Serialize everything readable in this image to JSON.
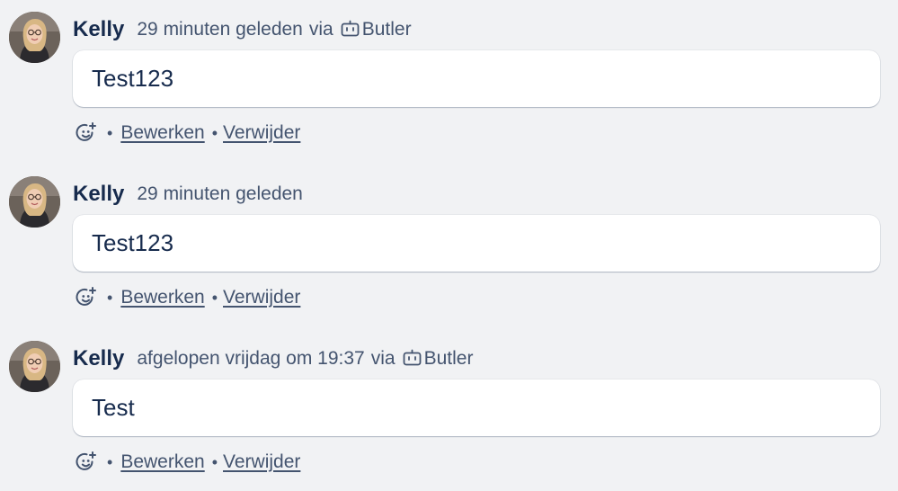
{
  "comments": [
    {
      "author": "Kelly",
      "time": "29 minuten geleden",
      "via": "via",
      "source": "Butler",
      "text": "Test123",
      "actions": {
        "edit": "Bewerken",
        "delete": "Verwijder"
      }
    },
    {
      "author": "Kelly",
      "time": "29 minuten geleden",
      "text": "Test123",
      "actions": {
        "edit": "Bewerken",
        "delete": "Verwijder"
      }
    },
    {
      "author": "Kelly",
      "time": "afgelopen vrijdag om 19:37",
      "via": "via",
      "source": "Butler",
      "text": "Test",
      "actions": {
        "edit": "Bewerken",
        "delete": "Verwijder"
      }
    }
  ],
  "icons": {
    "reaction": "add-reaction-icon",
    "bot": "butler-bot-icon",
    "separator": "•"
  },
  "colors": {
    "background": "#f1f2f4",
    "text": "#172b4d",
    "subtle": "#44546f",
    "card": "#ffffff"
  }
}
